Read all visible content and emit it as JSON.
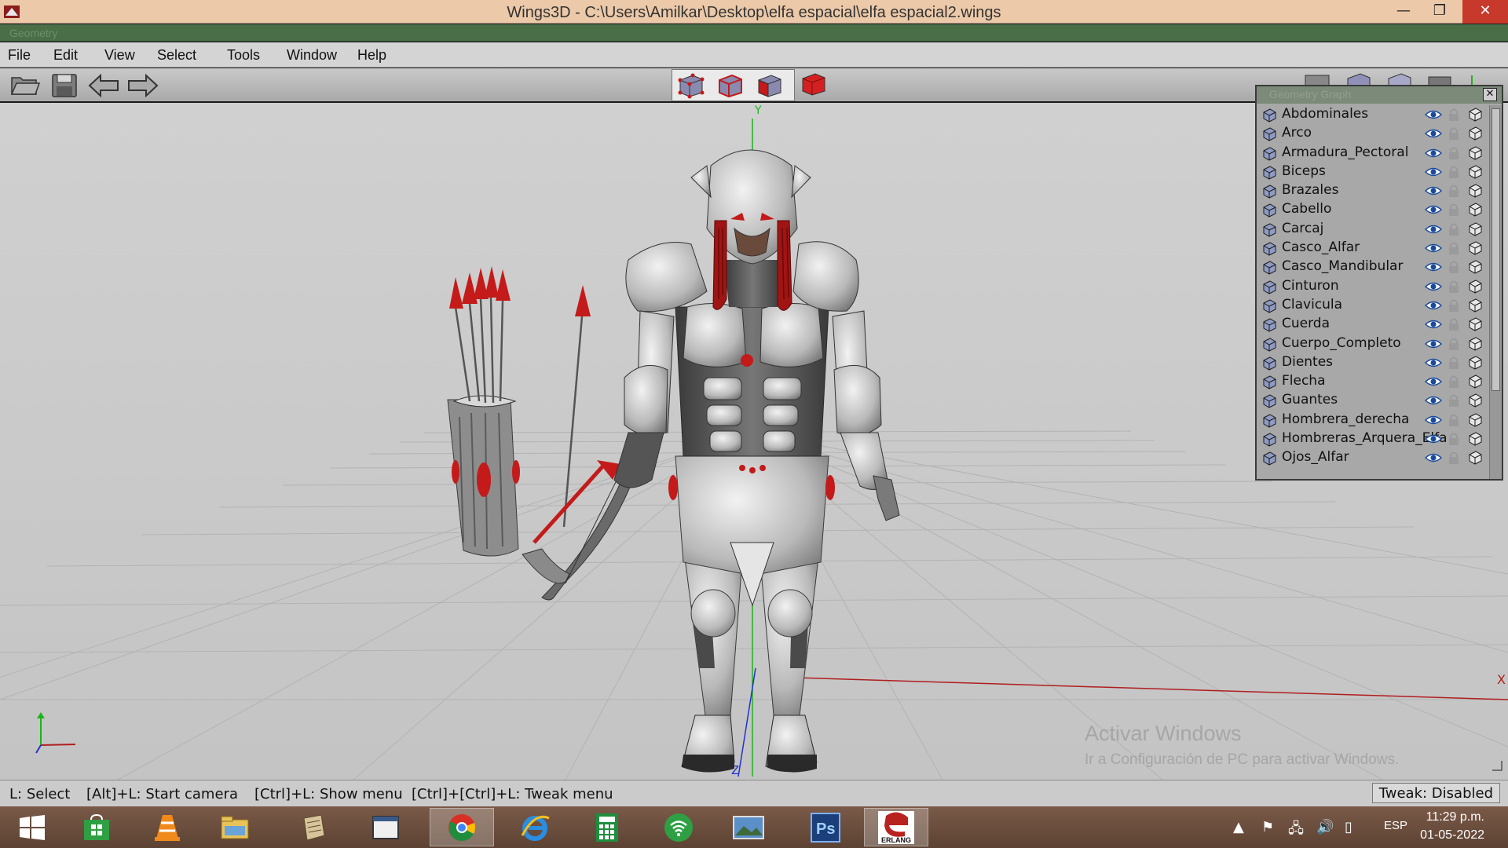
{
  "window": {
    "title": "Wings3D - C:\\Users\\Amilkar\\Desktop\\elfa espacial\\elfa espacial2.wings",
    "geometry_strip": "Geometry"
  },
  "menu": [
    "File",
    "Edit",
    "View",
    "Select",
    "Tools",
    "Window",
    "Help"
  ],
  "viewport": {
    "axis_y": "Y",
    "axis_z": "Z",
    "axis_x": "X",
    "watermark_title": "Activar Windows",
    "watermark_sub": "Ir a Configuración de PC para activar Windows."
  },
  "geometry_graph": {
    "title": "Geometry Graph",
    "objects": [
      "Abdominales",
      "Arco",
      "Armadura_Pectoral",
      "Biceps",
      "Brazales",
      "Cabello",
      "Carcaj",
      "Casco_Alfar",
      "Casco_Mandibular",
      "Cinturon",
      "Clavicula",
      "Cuerda",
      "Cuerpo_Completo",
      "Dientes",
      "Flecha",
      "Guantes",
      "Hombrera_derecha",
      "Hombreras_Arquera_Elfa",
      "Ojos_Alfar"
    ]
  },
  "status": {
    "hints": [
      "L: Select",
      "[Alt]+L: Start camera",
      "[Ctrl]+L: Show menu",
      "[Ctrl]+[Ctrl]+L: Tweak menu"
    ],
    "tweak": "Tweak: Disabled"
  },
  "taskbar": {
    "apps": [
      "start-icon",
      "store-icon",
      "vlc-icon",
      "file-explorer-icon",
      "scroll-app-icon",
      "window-app-icon",
      "chrome-icon",
      "internet-explorer-icon",
      "calculator-icon",
      "wifi-app-icon",
      "photos-icon",
      "photoshop-icon",
      "erlang-icon"
    ],
    "erlang_label": "ERLANG",
    "photoshop_label": "Ps",
    "lang": "ESP",
    "time": "11:29 p.m.",
    "date": "01-05-2022"
  },
  "colors": {
    "accent_red": "#c41a1a",
    "viewport_bg": "#c9c9c9",
    "axis_green": "#1db31d",
    "axis_red": "#b01e1e",
    "axis_blue": "#2233cc"
  }
}
